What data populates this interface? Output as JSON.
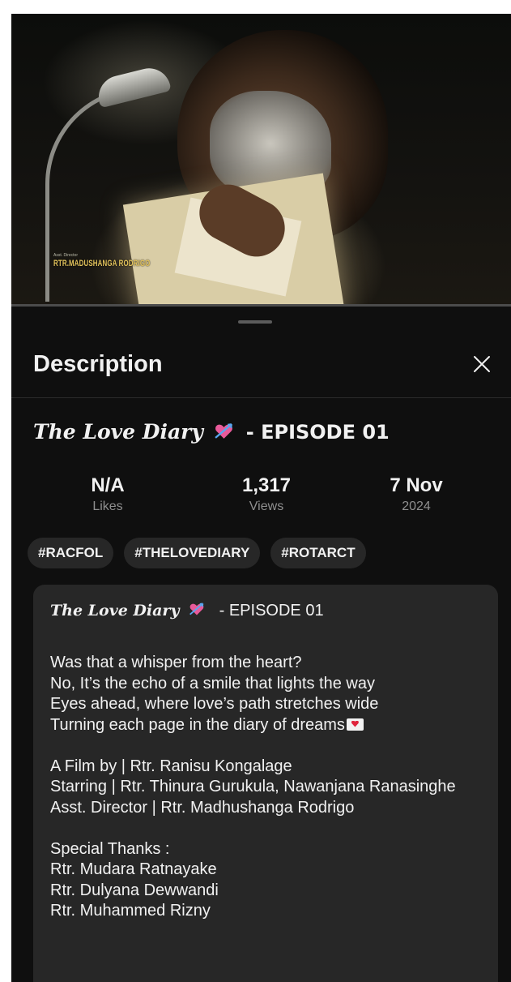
{
  "video": {
    "credit_text": "RTR.MADUSHANGA RODRIGO",
    "credit_small": "Asst. Director"
  },
  "sheet": {
    "title": "Description",
    "close_icon": "close-icon"
  },
  "video_title": {
    "name": "The Love Diary",
    "emoji": "heart-with-arrow",
    "episode": "- EPISODE 01"
  },
  "stats": [
    {
      "value": "N/A",
      "label": "Likes"
    },
    {
      "value": "1,317",
      "label": "Views"
    },
    {
      "value": "7 Nov",
      "label": "2024"
    }
  ],
  "tags": [
    "#RACFOL",
    "#THELOVEDIARY",
    "#ROTARCT"
  ],
  "description": {
    "title_name": "The Love Diary",
    "title_episode": "- EPISODE 01",
    "lines": [
      "Was that a whisper from the heart?",
      "No, It’s the echo of a smile that lights the way",
      "Eyes ahead, where love’s path stretches wide",
      "Turning each page in the diary of dreams",
      "",
      "A Film by | Rtr. Ranisu Kongalage",
      "Starring | Rtr. Thinura Gurukula, Nawanjana Ranasinghe",
      "Asst. Director | Rtr. Madhushanga Rodrigo",
      "",
      "Special Thanks :",
      "Rtr. Mudara Ratnayake",
      "Rtr. Dulyana Dewwandi",
      "Rtr. Muhammed Rizny"
    ]
  },
  "colors": {
    "background": "#0f0f0f",
    "card": "#272727",
    "text": "#f1f1f1",
    "muted": "#8f8f8f"
  }
}
